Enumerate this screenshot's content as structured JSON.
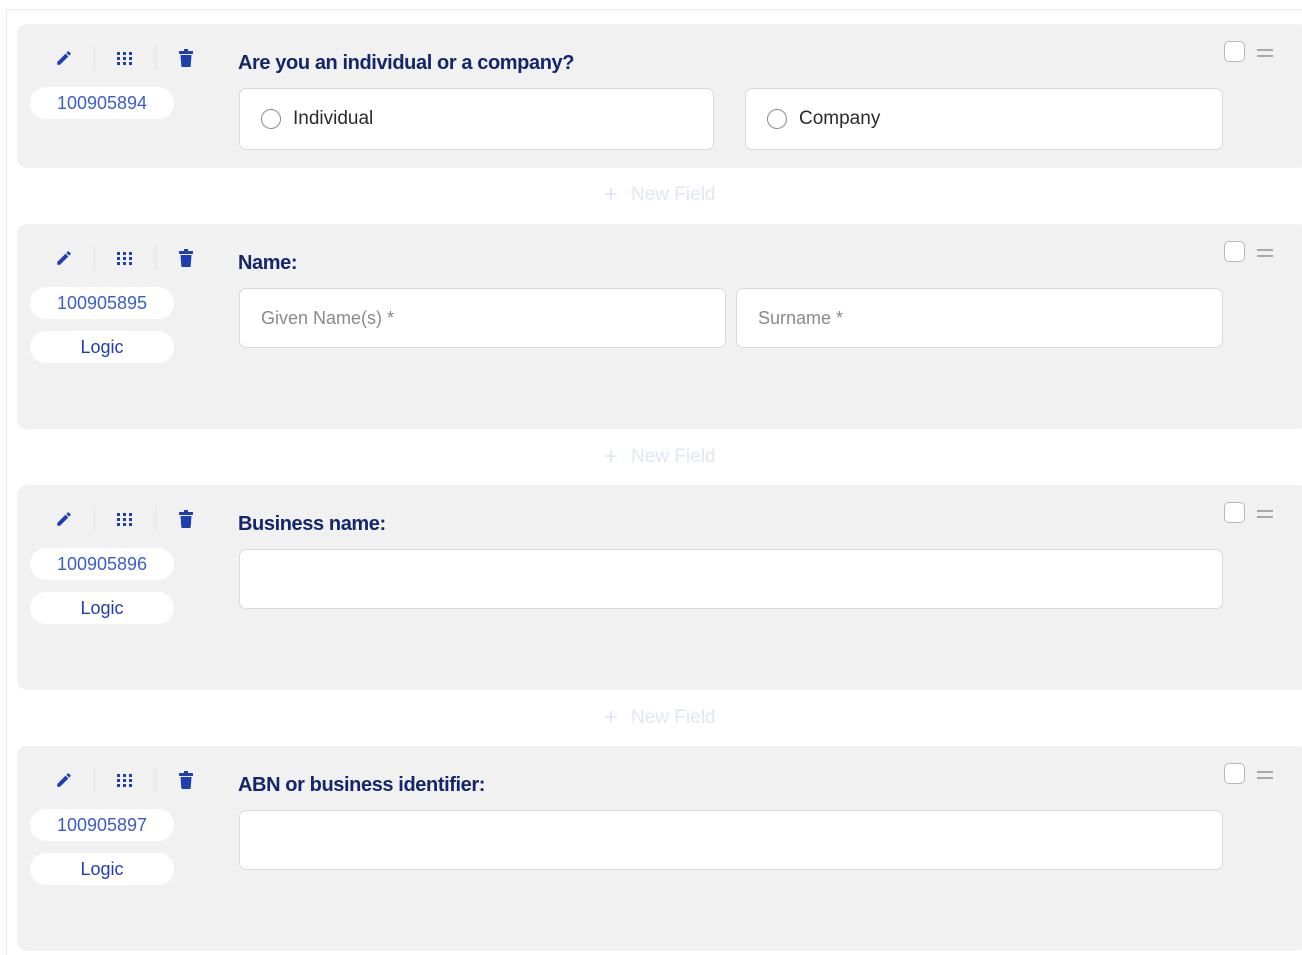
{
  "colors": {
    "accent": "#1f3fb0",
    "card_bg": "#f1f1f2",
    "label": "#13266b"
  },
  "new_field_label": "New Field",
  "fields": [
    {
      "id": "100905894",
      "label": "Are you an individual or a company?",
      "type": "radio",
      "options": [
        "Individual",
        "Company"
      ]
    },
    {
      "id": "100905895",
      "logic": "Logic",
      "label": "Name:",
      "type": "name",
      "inputs": [
        {
          "placeholder": "Given Name(s) *",
          "value": ""
        },
        {
          "placeholder": "Surname *",
          "value": ""
        }
      ]
    },
    {
      "id": "100905896",
      "logic": "Logic",
      "label": "Business name:",
      "type": "text",
      "value": ""
    },
    {
      "id": "100905897",
      "logic": "Logic",
      "label": "ABN or business identifier:",
      "type": "text",
      "value": ""
    }
  ],
  "icons": [
    "pencil-icon",
    "grid-icon",
    "trash-icon",
    "drag-handle-icon"
  ]
}
